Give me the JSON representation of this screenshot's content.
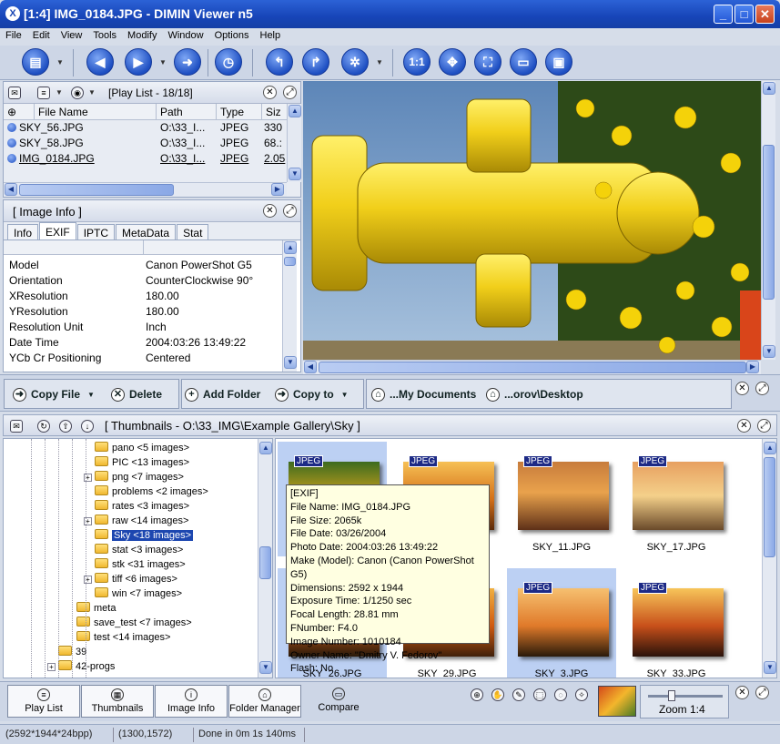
{
  "window": {
    "title": "[1:4] IMG_0184.JPG - DIMIN Viewer n5",
    "app_icon": "X"
  },
  "menu": [
    "File",
    "Edit",
    "View",
    "Tools",
    "Modify",
    "Window",
    "Options",
    "Help"
  ],
  "toolbar": {
    "zoom_11": "1:1"
  },
  "playlist": {
    "title": "[Play List - 18/18]",
    "columns": [
      "File Name",
      "Path",
      "Type",
      "Siz"
    ],
    "rows": [
      {
        "name": "SKY_56.JPG",
        "path": "O:\\33_I...",
        "type": "JPEG",
        "size": "330"
      },
      {
        "name": "SKY_58.JPG",
        "path": "O:\\33_I...",
        "type": "JPEG",
        "size": "68.:"
      },
      {
        "name": "IMG_0184.JPG",
        "path": "O:\\33_I...",
        "type": "JPEG",
        "size": "2.05"
      }
    ]
  },
  "imageinfo": {
    "title": "[ Image Info ]",
    "tabs": [
      "Info",
      "EXIF",
      "IPTC",
      "MetaData",
      "Stat"
    ],
    "rows": [
      {
        "k": "Model",
        "v": "Canon PowerShot G5"
      },
      {
        "k": "Orientation",
        "v": "CounterClockwise 90°"
      },
      {
        "k": "XResolution",
        "v": "180.00"
      },
      {
        "k": "YResolution",
        "v": "180.00"
      },
      {
        "k": "Resolution Unit",
        "v": "Inch"
      },
      {
        "k": "Date Time",
        "v": "2004:03:26 13:49:22"
      },
      {
        "k": "YCb Cr Positioning",
        "v": "Centered"
      }
    ]
  },
  "actions": {
    "copy_file": "Copy File",
    "delete": "Delete",
    "add_folder": "Add Folder",
    "copy_to": "Copy to",
    "my_documents": "...My Documents",
    "desktop": "...orov\\Desktop"
  },
  "thumbs_panel": {
    "title": "[ Thumbnails - O:\\33_IMG\\Example Gallery\\Sky ]"
  },
  "tree": [
    {
      "label": "pano  <5 images>",
      "plus": false,
      "indent": 1
    },
    {
      "label": "PIC  <13 images>",
      "plus": false,
      "indent": 1
    },
    {
      "label": "png  <7 images>",
      "plus": true,
      "indent": 1
    },
    {
      "label": "problems  <2 images>",
      "plus": false,
      "indent": 1
    },
    {
      "label": "rates  <3 images>",
      "plus": false,
      "indent": 1
    },
    {
      "label": "raw  <14 images>",
      "plus": true,
      "indent": 1
    },
    {
      "label": "Sky  <18 images>",
      "plus": false,
      "indent": 1,
      "selected": true
    },
    {
      "label": "stat  <3 images>",
      "plus": false,
      "indent": 1
    },
    {
      "label": "stk  <31 images>",
      "plus": false,
      "indent": 1
    },
    {
      "label": "tiff  <6 images>",
      "plus": true,
      "indent": 1
    },
    {
      "label": "win  <7 images>",
      "plus": false,
      "indent": 1
    },
    {
      "label": "meta",
      "plus": false,
      "indent": 0
    },
    {
      "label": "save_test  <7 images>",
      "plus": false,
      "indent": 0
    },
    {
      "label": "test  <14 images>",
      "plus": false,
      "indent": 0
    },
    {
      "label": "39",
      "plus": false,
      "indent": -1
    },
    {
      "label": "42-progs",
      "plus": true,
      "indent": -1
    }
  ],
  "thumbnails": [
    {
      "badge": "JPEG",
      "caption": "",
      "selected": true
    },
    {
      "badge": "JPEG",
      "caption": "",
      "selected": false
    },
    {
      "badge": "JPEG",
      "caption": "SKY_11.JPG",
      "selected": false
    },
    {
      "badge": "JPEG",
      "caption": "SKY_17.JPG",
      "selected": false
    },
    {
      "badge": "JPEG",
      "caption": "SKY_26.JPG",
      "selected": true
    },
    {
      "badge": "JPEG",
      "caption": "SKY_29.JPG",
      "selected": false
    },
    {
      "badge": "JPEG",
      "caption": "SKY_3.JPG",
      "selected": true
    },
    {
      "badge": "JPEG",
      "caption": "SKY_33.JPG",
      "selected": false
    }
  ],
  "tooltip": [
    "[EXIF]",
    "File Name: IMG_0184.JPG",
    "File Size: 2065k",
    "File Date: 03/26/2004",
    "Photo Date: 2004:03:26 13:49:22",
    "Make (Model): Canon (Canon PowerShot G5)",
    "Dimensions: 2592 x 1944",
    "Exposure Time: 1/1250 sec",
    "Focal Length: 28.81 mm",
    "FNumber: F4.0",
    "Image Number: 1010184",
    "Owner Name: \"Dmitry V. Fedorov\"",
    "Flash: No"
  ],
  "bottom": {
    "play_list": "Play List",
    "thumbnails": "Thumbnails",
    "image_info": "Image Info",
    "folder_manager": "Folder Manager",
    "compare": "Compare",
    "zoom": "Zoom 1:4"
  },
  "status": {
    "format": "(2592*1944*24bpp)",
    "coords": "(1300,1572)",
    "timing": "Done in 0m 1s 140ms"
  }
}
